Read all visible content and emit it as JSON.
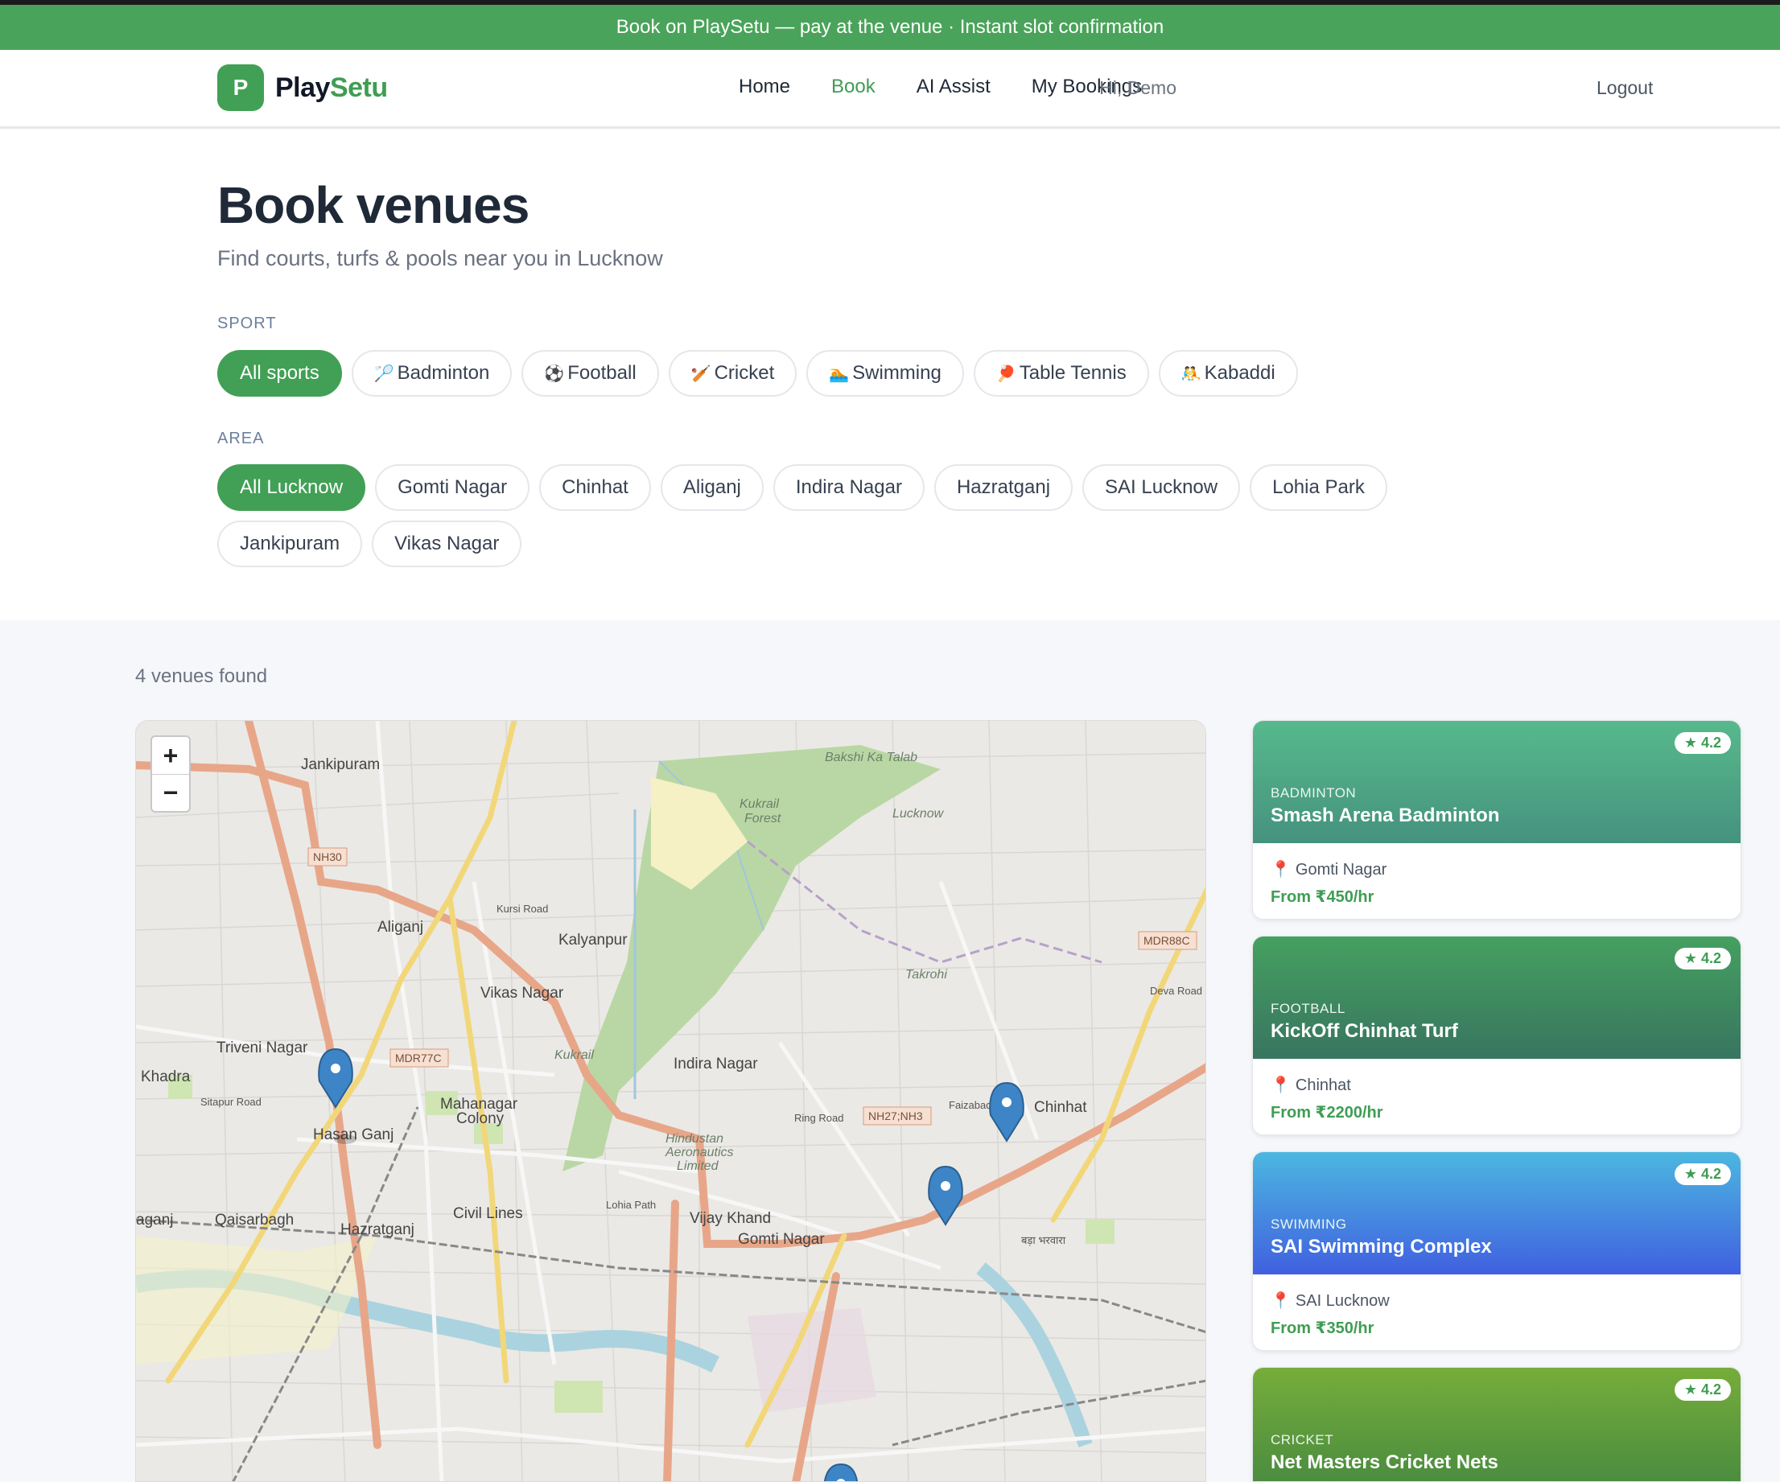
{
  "promo": "Book on PlaySetu — pay at the venue · Instant slot confirmation",
  "brand": {
    "logo_letter": "P",
    "name_part1": "Play",
    "name_part2": "Setu",
    "accent": "#41a055"
  },
  "nav": {
    "home": "Home",
    "book": "Book",
    "ai": "AI Assist",
    "bookings": "My Bookings"
  },
  "user": {
    "greeting": "Hi, Demo",
    "logout": "Logout"
  },
  "hero": {
    "title": "Book venues",
    "subtitle": "Find courts, turfs & pools near you in Lucknow"
  },
  "filters": {
    "sport_label": "SPORT",
    "sports": [
      {
        "icon": "all",
        "label": "All sports",
        "active": true
      },
      {
        "icon": "🏸",
        "label": "Badminton"
      },
      {
        "icon": "⚽",
        "label": "Football"
      },
      {
        "icon": "🏏",
        "label": "Cricket"
      },
      {
        "icon": "🏊",
        "label": "Swimming"
      },
      {
        "icon": "🏓",
        "label": "Table Tennis"
      },
      {
        "icon": "🤼",
        "label": "Kabaddi"
      }
    ],
    "area_label": "AREA",
    "areas": [
      "All Lucknow",
      "Gomti Nagar",
      "Chinhat",
      "Aliganj",
      "Indira Nagar",
      "Hazratganj",
      "SAI Lucknow",
      "Lohia Park",
      "Jankipuram",
      "Vikas Nagar"
    ]
  },
  "results": {
    "count": "4 venues found"
  },
  "map": {
    "zoom_in": "+",
    "zoom_out": "−",
    "labels": {
      "jankipuram": "Jankipuram",
      "nh30": "NH30",
      "aliganj": "Aliganj",
      "kalyanpur": "Kalyanpur",
      "vikas": "Vikas Nagar",
      "triveni": "Triveni Nagar",
      "mdr77c": "MDR77C",
      "khadra": "Khadra",
      "indira": "Indira Nagar",
      "mahanagar1": "Mahanagar",
      "mahanagar2": "Colony",
      "hasan": "Hasan Ganj",
      "chinhat": "Chinhat",
      "qaisar": "Qaisarbagh",
      "civil": "Civil Lines",
      "hazrat": "Hazratganj",
      "vijay": "Vijay Khand",
      "gomti": "Gomti Nagar",
      "aganj": "aganj",
      "kukrail1": "Kukrail",
      "kukrail2": "Forest",
      "takrohi": "Takrohi",
      "mdr88c": "MDR88C",
      "ringroad": "Ring Road",
      "nh27": "NH27;NH3",
      "hal1": "Hindustan",
      "hal2": "Aeronautics",
      "hal3": "Limited",
      "hindi": "बड़ा भरवारा",
      "kursi": "Kursi Road",
      "faizabad": "Faizabad Road",
      "deva": "Deva Road",
      "sitapur": "Sitapur Road",
      "bakshi": "Bakshi Ka Talab",
      "lucknow": "Lucknow",
      "kukrail3": "Kukrail",
      "lohia": "Lohia Path"
    }
  },
  "venues": [
    {
      "sport": "BADMINTON",
      "name": "Smash Arena Badminton",
      "area": "Gomti Nagar",
      "price": "From ₹450/hr",
      "rating": "★ 4.2"
    },
    {
      "sport": "FOOTBALL",
      "name": "KickOff Chinhat Turf",
      "area": "Chinhat",
      "price": "From ₹2200/hr",
      "rating": "★ 4.2"
    },
    {
      "sport": "SWIMMING",
      "name": "SAI Swimming Complex",
      "area": "SAI Lucknow",
      "price": "From ₹350/hr",
      "rating": "★ 4.2"
    },
    {
      "sport": "CRICKET",
      "name": "Net Masters Cricket Nets",
      "area": "",
      "price": "",
      "rating": "★ 4.2"
    }
  ]
}
